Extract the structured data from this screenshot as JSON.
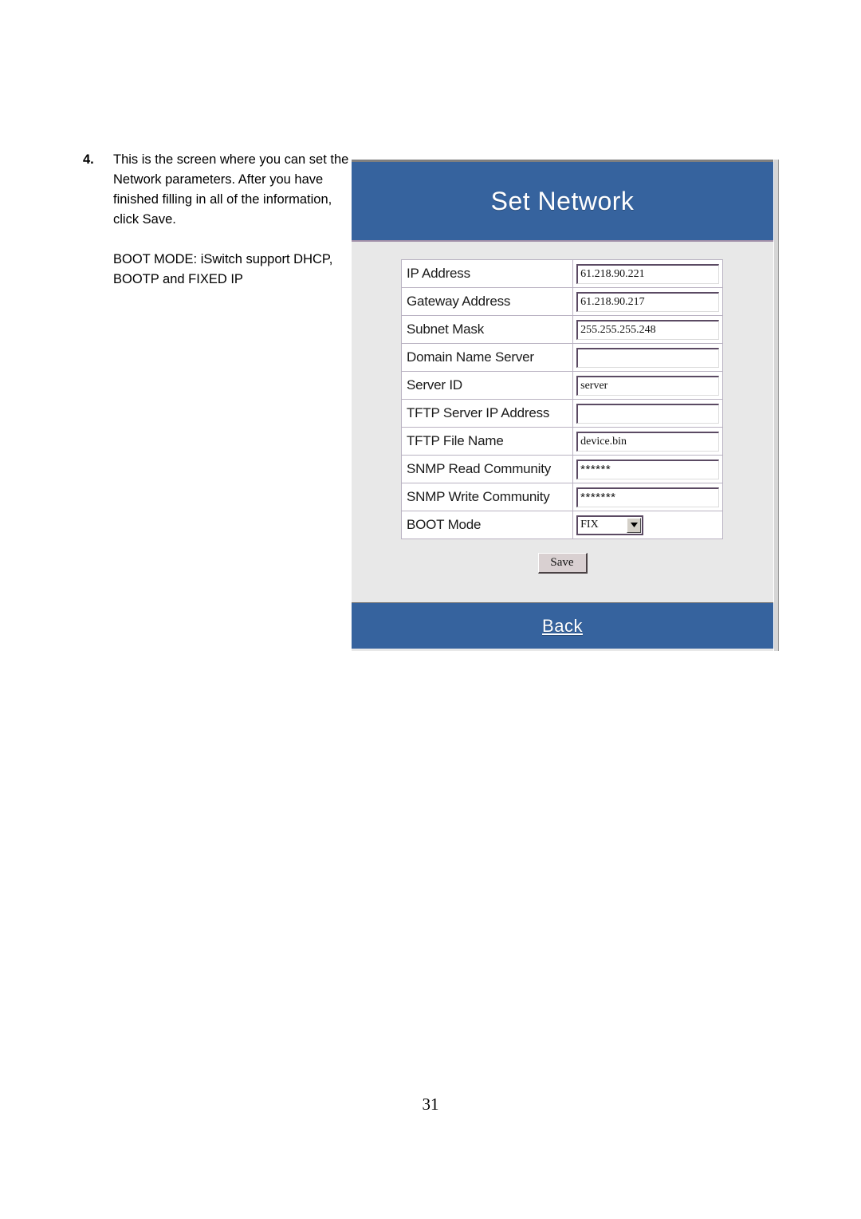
{
  "document": {
    "page_number": "31"
  },
  "instructions": {
    "step_number": "4.",
    "paragraph": "This is the screen where you can set the Network parameters.  After you have finished filling in all of the information, click Save.",
    "note": "BOOT MODE: iSwitch support DHCP, BOOTP and FIXED IP"
  },
  "screenshot": {
    "header": {
      "title": "Set Network",
      "background_color": "#36639e"
    },
    "form": {
      "rows": [
        {
          "label": "IP Address",
          "value": "61.218.90.221",
          "type": "text"
        },
        {
          "label": "Gateway Address",
          "value": "61.218.90.217",
          "type": "text"
        },
        {
          "label": "Subnet Mask",
          "value": "255.255.255.248",
          "type": "text"
        },
        {
          "label": "Domain Name Server",
          "value": "",
          "type": "text"
        },
        {
          "label": "Server ID",
          "value": "server",
          "type": "text"
        },
        {
          "label": "TFTP Server IP Address",
          "value": "",
          "type": "text"
        },
        {
          "label": "TFTP File Name",
          "value": "device.bin",
          "type": "text"
        },
        {
          "label": "SNMP Read Community",
          "value": "******",
          "type": "password"
        },
        {
          "label": "SNMP Write Community",
          "value": "*******",
          "type": "password"
        },
        {
          "label": "BOOT Mode",
          "value": "FIX",
          "type": "select"
        }
      ]
    },
    "save_button": {
      "label": "Save"
    },
    "footer": {
      "back_label": "Back",
      "background_color": "#36639e"
    }
  }
}
